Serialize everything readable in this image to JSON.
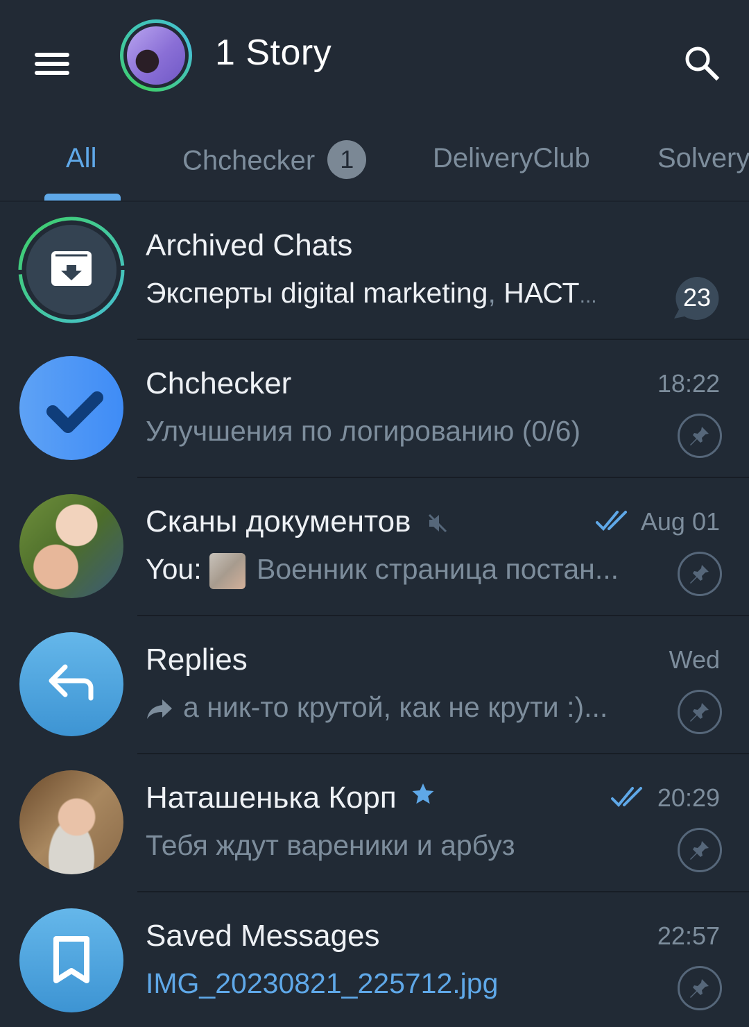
{
  "header": {
    "title": "1 Story",
    "menu_icon": "hamburger-menu-icon",
    "search_icon": "search-icon"
  },
  "tabs": [
    {
      "label": "All",
      "active": true
    },
    {
      "label": "Chchecker",
      "badge": "1"
    },
    {
      "label": "DeliveryClub"
    },
    {
      "label": "Solvery"
    }
  ],
  "colors": {
    "accent": "#5fa8e8",
    "background": "#212a35",
    "muted_text": "#7d8d9c",
    "story_ring": "#3fcf67"
  },
  "chats": [
    {
      "name": "Archived Chats",
      "preview_bold": "Эксперты digital marketing",
      "preview_sep": ", ",
      "preview_rest": "НАСТ",
      "ellipsis": "...",
      "unread": "23",
      "icon": "archive-icon"
    },
    {
      "name": "Chchecker",
      "preview": "Улучшения по логированию (0/6)",
      "time": "18:22",
      "pinned": true,
      "icon": "checkmark-icon"
    },
    {
      "name": "Сканы документов",
      "muted": true,
      "read_status": "double-check",
      "time": "Aug 01",
      "preview_prefix": "You: ",
      "preview": "Военник страница постан...",
      "pinned": true
    },
    {
      "name": "Replies",
      "time": "Wed",
      "preview": "а ник-то крутой, как не крути :)...",
      "forwarded": true,
      "pinned": true,
      "icon": "reply-arrow-icon"
    },
    {
      "name": "Наташенька Корп",
      "premium": true,
      "read_status": "double-check",
      "time": "20:29",
      "preview": "Тебя ждут вареники и арбуз",
      "pinned": true
    },
    {
      "name": "Saved Messages",
      "time": "22:57",
      "preview": "IMG_20230821_225712.jpg",
      "pinned": true,
      "icon": "bookmark-icon"
    }
  ]
}
